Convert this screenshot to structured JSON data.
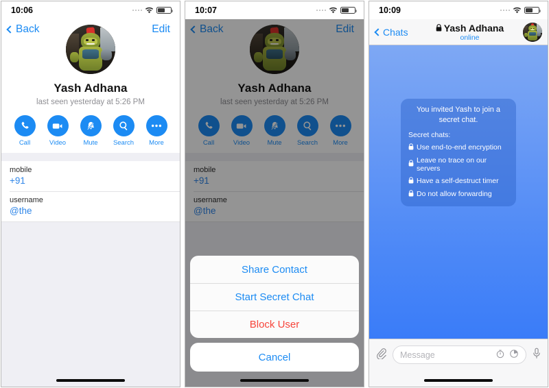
{
  "panels": {
    "profile": {
      "status_bar": {
        "time": "10:06",
        "signal_icon": "signal-dots-icon",
        "wifi_icon": "wifi-icon",
        "battery_icon": "battery-icon"
      },
      "nav": {
        "back_label": "Back",
        "edit_label": "Edit",
        "back_icon": "chevron-left-icon"
      },
      "name": "Yash Adhana",
      "last_seen": "last seen yesterday at 5:26 PM",
      "avatar_alt": "contact-avatar",
      "actions": [
        {
          "label": "Call",
          "icon": "phone-icon"
        },
        {
          "label": "Video",
          "icon": "video-camera-icon"
        },
        {
          "label": "Mute",
          "icon": "bell-slash-icon"
        },
        {
          "label": "Search",
          "icon": "search-icon"
        },
        {
          "label": "More",
          "icon": "ellipsis-icon"
        }
      ],
      "info_rows": [
        {
          "label": "mobile",
          "value": "+91"
        },
        {
          "label": "username",
          "value": "@the"
        }
      ]
    },
    "action_sheet_screen": {
      "status_bar": {
        "time": "10:07"
      },
      "nav": {
        "back_label": "Back",
        "edit_label": "Edit"
      },
      "name": "Yash Adhana",
      "last_seen": "last seen yesterday at 5:26 PM",
      "actions": [
        {
          "label": "Call",
          "icon": "phone-icon"
        },
        {
          "label": "Video",
          "icon": "video-camera-icon"
        },
        {
          "label": "Mute",
          "icon": "bell-slash-icon"
        },
        {
          "label": "Search",
          "icon": "search-icon"
        },
        {
          "label": "More",
          "icon": "ellipsis-icon"
        }
      ],
      "info_rows": [
        {
          "label": "mobile",
          "value": "+91"
        },
        {
          "label": "username",
          "value": "@the"
        }
      ],
      "sheet": {
        "items": [
          {
            "label": "Share Contact",
            "style": "default"
          },
          {
            "label": "Start Secret Chat",
            "style": "default"
          },
          {
            "label": "Block User",
            "style": "destructive"
          }
        ],
        "cancel_label": "Cancel"
      }
    },
    "secret_chat": {
      "status_bar": {
        "time": "10:09"
      },
      "nav": {
        "back_label": "Chats",
        "back_icon": "chevron-left-icon",
        "lock_icon": "lock-icon",
        "title": "Yash Adhana",
        "subtitle": "online",
        "avatar_alt": "chat-avatar"
      },
      "service_message": {
        "title": "You invited Yash to join a secret chat.",
        "subtitle": "Secret chats:",
        "bullets": [
          "Use end-to-end encryption",
          "Leave no trace on our servers",
          "Have a self-destruct timer",
          "Do not allow forwarding"
        ],
        "bullet_icon": "lock-icon"
      },
      "input_bar": {
        "attach_icon": "paperclip-icon",
        "placeholder": "Message",
        "timer_icon": "self-destruct-timer-icon",
        "sticker_icon": "sticker-icon",
        "mic_icon": "microphone-icon"
      }
    }
  },
  "colors": {
    "accent_blue": "#1c8bf3",
    "destructive_red": "#f7453b",
    "list_bg": "#efeff4",
    "chat_gradient_top": "#7ea8f4",
    "chat_gradient_bottom": "#3a7cf8",
    "bubble": "#2b63c8"
  }
}
